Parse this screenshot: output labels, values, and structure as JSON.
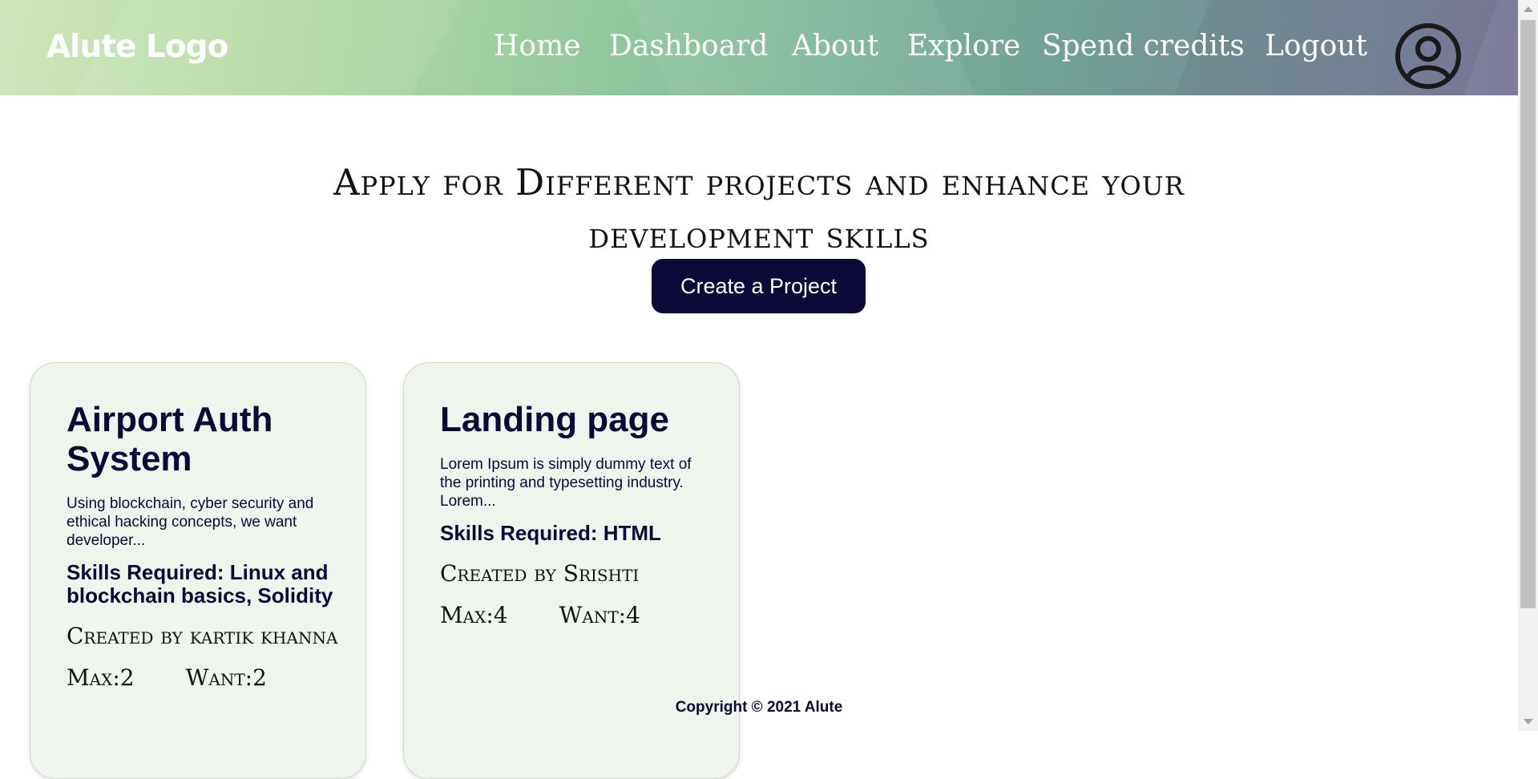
{
  "navbar": {
    "logo": "Alute Logo",
    "links": [
      "Home",
      "Dashboard",
      "About",
      "Explore",
      "Spend credits",
      "Logout"
    ],
    "avatar_icon": "user-circle-icon"
  },
  "main": {
    "headline": "Apply for Different projects and enhance your development skills",
    "create_button": "Create a Project"
  },
  "projects": [
    {
      "title": "Airport Auth System",
      "description": "Using blockchain, cyber security and ethical hacking concepts, we want developer...",
      "skills": "Skills Required: Linux and blockchain basics, Solidity",
      "creator": "Created by kartik khanna",
      "max": "Max:2",
      "want": "Want:2"
    },
    {
      "title": "Landing page",
      "description": "Lorem Ipsum is simply dummy text of the printing and typesetting industry. Lorem...",
      "skills": "Skills Required: HTML",
      "creator": "Created by Srishti",
      "max": "Max:4",
      "want": "Want:4"
    }
  ],
  "footer": {
    "copyright": "Copyright © 2021 Alute"
  },
  "colors": {
    "brand_dark": "#0c0838",
    "card_bg": "#eff5ec"
  }
}
